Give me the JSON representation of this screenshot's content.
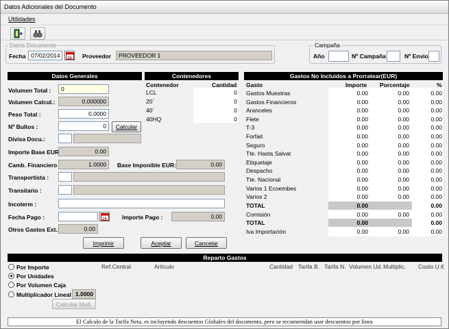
{
  "window": {
    "title": "Datos Adicionales del Documento"
  },
  "menu": {
    "utilidades": "Utilidades"
  },
  "toolbar": {
    "exit_icon": "exit-door-icon",
    "search_icon": "binoculars-icon"
  },
  "datos_documento": {
    "title": "Datos Documento",
    "fecha_label": "Fecha",
    "fecha_value": "07/02/2014",
    "proveedor_label": "Proveedor",
    "proveedor_value": "PROVEEDOR 1"
  },
  "campana": {
    "title": "Campaña",
    "ano_label": "Año",
    "num_campana_label": "Nº Campaña",
    "num_envio_label": "Nº Envio"
  },
  "datos_generales": {
    "header": "Datos Generales",
    "volumen_total_label": "Volumen Total :",
    "volumen_total_value": "0",
    "volumen_calcul_label": "Volumen Calcul.:",
    "volumen_calcul_value": "0.000000",
    "peso_total_label": "Peso Total :",
    "peso_total_value": "0.0000",
    "bultos_label": "Nº Bultos :",
    "bultos_value": "0",
    "calcular_label": "Calcular",
    "divisa_label": "Divisa Docu.:",
    "importe_base_label": "Importe Base EUR",
    "importe_base_value": "0.00",
    "camb_financiero_label": "Camb. Financiero",
    "camb_financiero_value": "1.0000",
    "base_imponible_label": "Base Imponible EUR:",
    "base_imponible_value": "0.00",
    "transportista_label": "Transportista :",
    "transitario_label": "Transitario :",
    "incoterm_label": "Incoterm :",
    "fecha_pago_label": "Fecha Pago :",
    "importe_pago_label": "Importe Pago :",
    "importe_pago_value": "0.00",
    "otros_gastos_label": "Otros Gastos Ext.:",
    "otros_gastos_value": "0.00"
  },
  "contenedores": {
    "header": "Contenedores",
    "col_contenedor": "Contenedor",
    "col_cantidad": "Cantidad",
    "rows": [
      {
        "name": "LCL",
        "qty": "0"
      },
      {
        "name": "20´",
        "qty": "0"
      },
      {
        "name": "40´",
        "qty": "0"
      },
      {
        "name": "40HQ",
        "qty": "0"
      }
    ]
  },
  "gastos": {
    "header": "Gastos No Incluidos a Prorratear(EUR)",
    "col_gasto": "Gasto",
    "col_importe": "Importe",
    "col_porcentaje": "Porcentaje",
    "col_pct": "%",
    "rows": [
      {
        "name": "Gastos Muestras",
        "importe": "0.00",
        "porcentaje": "0.00",
        "pct": "0.00",
        "bold": false
      },
      {
        "name": "Gastos Financieros",
        "importe": "0.00",
        "porcentaje": "0.00",
        "pct": "0.00",
        "bold": false
      },
      {
        "name": "Aranceles",
        "importe": "0.00",
        "porcentaje": "0.00",
        "pct": "0.00",
        "bold": false
      },
      {
        "name": "Flete",
        "importe": "0.00",
        "porcentaje": "0.00",
        "pct": "0.00",
        "bold": false
      },
      {
        "name": "T-3",
        "importe": "0.00",
        "porcentaje": "0.00",
        "pct": "0.00",
        "bold": false
      },
      {
        "name": "Forfait",
        "importe": "0.00",
        "porcentaje": "0.00",
        "pct": "0.00",
        "bold": false
      },
      {
        "name": "Seguro",
        "importe": "0.00",
        "porcentaje": "0.00",
        "pct": "0.00",
        "bold": false
      },
      {
        "name": "Tte. Hasta Salvat",
        "importe": "0.00",
        "porcentaje": "0.00",
        "pct": "0.00",
        "bold": false
      },
      {
        "name": "Etiquetaje",
        "importe": "0.00",
        "porcentaje": "0.00",
        "pct": "0.00",
        "bold": false
      },
      {
        "name": "Despacho",
        "importe": "0.00",
        "porcentaje": "0.00",
        "pct": "0.00",
        "bold": false
      },
      {
        "name": "Tte. Nacional",
        "importe": "0.00",
        "porcentaje": "0.00",
        "pct": "0.00",
        "bold": false
      },
      {
        "name": "Varios 1 Ecoembes",
        "importe": "0.00",
        "porcentaje": "0.00",
        "pct": "0.00",
        "bold": false
      },
      {
        "name": "Varios 2",
        "importe": "0.00",
        "porcentaje": "0.00",
        "pct": "0.00",
        "bold": false
      }
    ],
    "total1_label": "TOTAL",
    "total1_importe": "0.00",
    "total1_pct": "0.00",
    "comision_label": "Comisión",
    "comision_importe": "0.00",
    "comision_porcentaje": "0.00",
    "comision_pct": "0.00",
    "total2_label": "TOTAL",
    "total2_importe": "0.00",
    "total2_pct": "0.00",
    "iva_label": "Iva Importación",
    "iva_importe": "0.00",
    "iva_porcentaje": "0.00",
    "iva_pct": "0.00"
  },
  "buttons": {
    "imprimir": "Imprimir",
    "aceptar": "Aceptar",
    "cancelar": "Cancelar"
  },
  "reparto": {
    "header": "Reparto Gastos",
    "por_importe": "Por Importe",
    "por_unidades": "Por Unidades",
    "por_volumen": "Por Volumen Caja",
    "multiplicador": "Multiplicador Lineal",
    "multiplicador_value": "1.0000",
    "calcular_mult": "Calcular Mult.",
    "cols": [
      "Ref.Central",
      "Artículo",
      "Cantidad",
      "Tarifa B.",
      "Tarifa N.",
      "Volumen Ud.",
      "Multiplic.",
      "Costo U.€"
    ]
  },
  "status": {
    "text": "El Calculo de la Tarifa Neta, es incluyendo descuentos Globales del documento, pero se recomiendan usar descuentos por linea"
  }
}
